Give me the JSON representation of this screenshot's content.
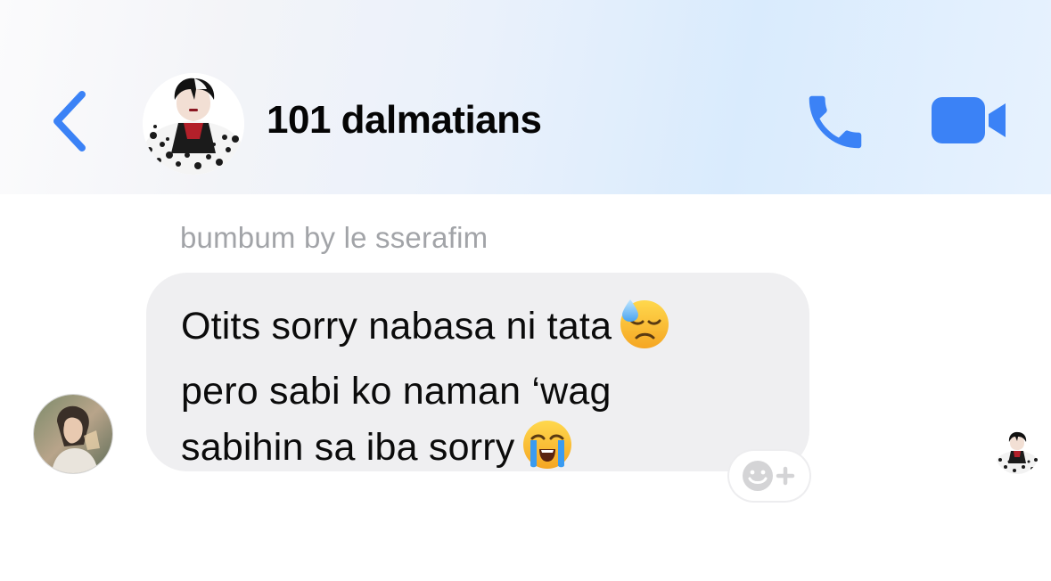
{
  "header": {
    "title": "101 dalmatians",
    "back_icon": "chevron-left-icon",
    "call_icon": "phone-icon",
    "video_icon": "video-camera-icon",
    "accent_color": "#3b82f6"
  },
  "conversation": {
    "reply_context": "bumbum by le sserafim",
    "message": {
      "lines": [
        "Otits sorry nabasa ni tata",
        "pero sabi ko naman ‘wag",
        "sabihin sa iba sorry"
      ],
      "emojis": [
        "downcast-face-with-sweat-emoji",
        "loudly-crying-face-emoji"
      ],
      "bubble_color": "#efeff1"
    },
    "reaction_icon": "add-reaction-icon"
  }
}
